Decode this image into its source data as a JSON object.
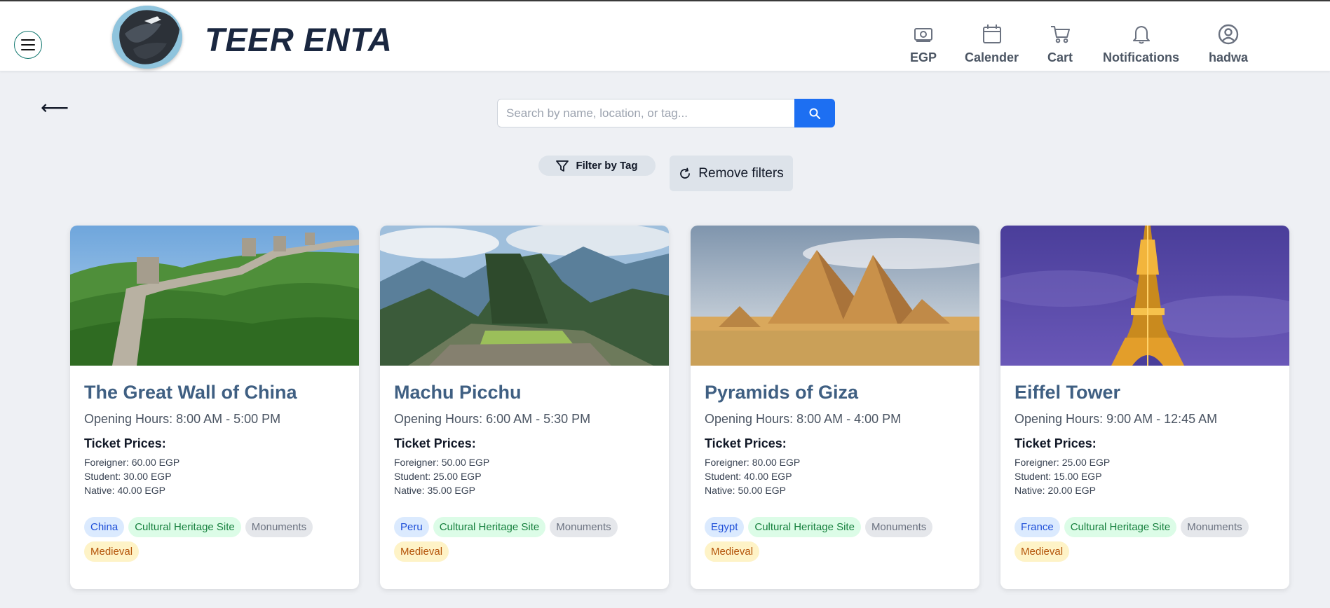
{
  "app": {
    "brand": "TEER ENTA"
  },
  "nav": [
    {
      "label": "EGP",
      "icon": "currency-icon"
    },
    {
      "label": "Calender",
      "icon": "calendar-icon"
    },
    {
      "label": "Cart",
      "icon": "cart-icon"
    },
    {
      "label": "Notifications",
      "icon": "bell-icon"
    },
    {
      "label": "hadwa",
      "icon": "user-icon"
    }
  ],
  "back": {
    "glyph": "⟵"
  },
  "search": {
    "placeholder": "Search by name, location, or tag...",
    "value": ""
  },
  "filters": {
    "filter_by_tag": "Filter by Tag",
    "remove_filters": "Remove filters"
  },
  "cards": [
    {
      "title": "The Great Wall of China",
      "hours": "Opening Hours: 8:00 AM - 5:00 PM",
      "prices_heading": "Ticket Prices:",
      "prices": [
        {
          "label": "Foreigner:",
          "value": "60.00 EGP"
        },
        {
          "label": "Student:",
          "value": "30.00 EGP"
        },
        {
          "label": "Native:",
          "value": "40.00 EGP"
        }
      ],
      "tags": [
        {
          "text": "China",
          "kind": "country"
        },
        {
          "text": "Cultural Heritage Site",
          "kind": "heritage"
        },
        {
          "text": "Monuments",
          "kind": "monument"
        },
        {
          "text": "Medieval",
          "kind": "medieval"
        }
      ]
    },
    {
      "title": "Machu Picchu",
      "hours": "Opening Hours: 6:00 AM - 5:30 PM",
      "prices_heading": "Ticket Prices:",
      "prices": [
        {
          "label": "Foreigner:",
          "value": "50.00 EGP"
        },
        {
          "label": "Student:",
          "value": "25.00 EGP"
        },
        {
          "label": "Native:",
          "value": "35.00 EGP"
        }
      ],
      "tags": [
        {
          "text": "Peru",
          "kind": "country"
        },
        {
          "text": "Cultural Heritage Site",
          "kind": "heritage"
        },
        {
          "text": "Monuments",
          "kind": "monument"
        },
        {
          "text": "Medieval",
          "kind": "medieval"
        }
      ]
    },
    {
      "title": "Pyramids of Giza",
      "hours": "Opening Hours: 8:00 AM - 4:00 PM",
      "prices_heading": "Ticket Prices:",
      "prices": [
        {
          "label": "Foreigner:",
          "value": "80.00 EGP"
        },
        {
          "label": "Student:",
          "value": "40.00 EGP"
        },
        {
          "label": "Native:",
          "value": "50.00 EGP"
        }
      ],
      "tags": [
        {
          "text": "Egypt",
          "kind": "country"
        },
        {
          "text": "Cultural Heritage Site",
          "kind": "heritage"
        },
        {
          "text": "Monuments",
          "kind": "monument"
        },
        {
          "text": "Medieval",
          "kind": "medieval"
        }
      ]
    },
    {
      "title": "Eiffel Tower",
      "hours": "Opening Hours: 9:00 AM - 12:45 AM",
      "prices_heading": "Ticket Prices:",
      "prices": [
        {
          "label": "Foreigner:",
          "value": "25.00 EGP"
        },
        {
          "label": "Student:",
          "value": "15.00 EGP"
        },
        {
          "label": "Native:",
          "value": "20.00 EGP"
        }
      ],
      "tags": [
        {
          "text": "France",
          "kind": "country"
        },
        {
          "text": "Cultural Heritage Site",
          "kind": "heritage"
        },
        {
          "text": "Monuments",
          "kind": "monument"
        },
        {
          "text": "Medieval",
          "kind": "medieval"
        }
      ]
    }
  ],
  "colors": {
    "accent": "#1d6ff2",
    "brand_text": "#1a2740",
    "card_title": "#3f5f82",
    "page_bg": "#eef0f4"
  }
}
